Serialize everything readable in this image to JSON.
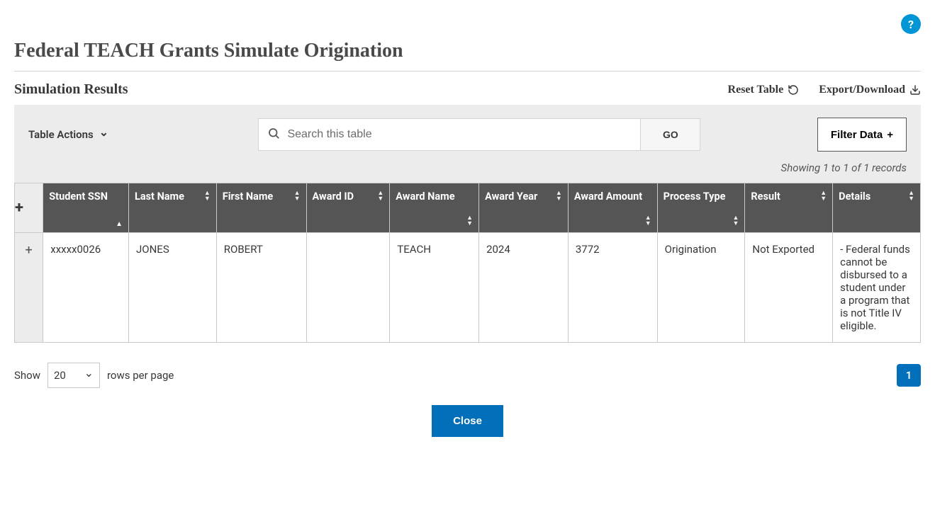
{
  "help_icon_glyph": "?",
  "page_title": "Federal TEACH Grants Simulate Origination",
  "subtitle": "Simulation Results",
  "actions": {
    "reset_table": "Reset Table",
    "export_download": "Export/Download"
  },
  "toolbar": {
    "table_actions_label": "Table Actions",
    "search_placeholder": "Search this table",
    "go_label": "GO",
    "filter_label": "Filter Data",
    "filter_plus": "+"
  },
  "record_count_text": "Showing 1 to 1 of 1 records",
  "table": {
    "expand_header": "+",
    "columns": {
      "ssn": "Student SSN",
      "last": "Last Name",
      "first": "First Name",
      "award_id": "Award ID",
      "award_name": "Award Name",
      "award_year": "Award Year",
      "award_amount": "Award Amount",
      "process_type": "Process Type",
      "result": "Result",
      "details": "Details"
    },
    "rows": [
      {
        "expand": "+",
        "ssn": "xxxxx0026",
        "last": "JONES",
        "first": "ROBERT",
        "award_id": "",
        "award_name": "TEACH",
        "award_year": "2024",
        "award_amount": "3772",
        "process_type": "Origination",
        "result": "Not Exported",
        "details": " - Federal funds cannot be disbursed to a student under a program that is not Title IV eligible."
      }
    ]
  },
  "pager": {
    "show_label": "Show",
    "rows_per_page_label": "rows per page",
    "page_size": "20",
    "current_page": "1"
  },
  "close_label": "Close"
}
